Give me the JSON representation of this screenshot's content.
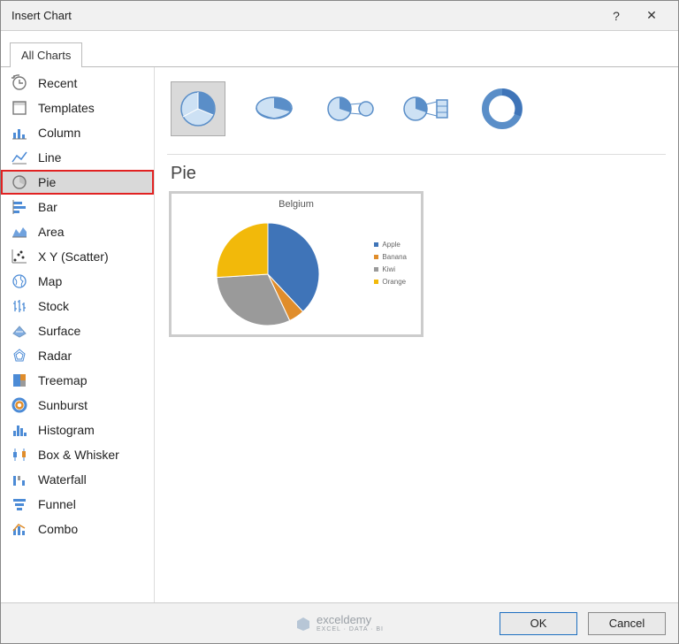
{
  "dialog": {
    "title": "Insert Chart",
    "help_label": "?",
    "close_label": "✕",
    "ok_label": "OK",
    "cancel_label": "Cancel"
  },
  "tabs": {
    "all_charts": "All Charts"
  },
  "sidebar": {
    "items": [
      {
        "label": "Recent"
      },
      {
        "label": "Templates"
      },
      {
        "label": "Column"
      },
      {
        "label": "Line"
      },
      {
        "label": "Pie",
        "selected": true,
        "highlight": true
      },
      {
        "label": "Bar"
      },
      {
        "label": "Area"
      },
      {
        "label": "X Y (Scatter)"
      },
      {
        "label": "Map"
      },
      {
        "label": "Stock"
      },
      {
        "label": "Surface"
      },
      {
        "label": "Radar"
      },
      {
        "label": "Treemap"
      },
      {
        "label": "Sunburst"
      },
      {
        "label": "Histogram"
      },
      {
        "label": "Box & Whisker"
      },
      {
        "label": "Waterfall"
      },
      {
        "label": "Funnel"
      },
      {
        "label": "Combo"
      }
    ]
  },
  "main": {
    "heading": "Pie",
    "preview_title": "Belgium",
    "legend": [
      {
        "label": "Apple",
        "color": "#3f74b8"
      },
      {
        "label": "Banana",
        "color": "#e08d2b"
      },
      {
        "label": "Kiwi",
        "color": "#9a9a9a"
      },
      {
        "label": "Orange",
        "color": "#f2b90a"
      }
    ]
  },
  "chart_data": {
    "type": "pie",
    "title": "Belgium",
    "categories": [
      "Apple",
      "Banana",
      "Kiwi",
      "Orange"
    ],
    "values": [
      38,
      5,
      31,
      26
    ],
    "colors": [
      "#3f74b8",
      "#e08d2b",
      "#9a9a9a",
      "#f2b90a"
    ]
  },
  "watermark": {
    "brand": "exceldemy",
    "tagline": "EXCEL · DATA · BI"
  }
}
